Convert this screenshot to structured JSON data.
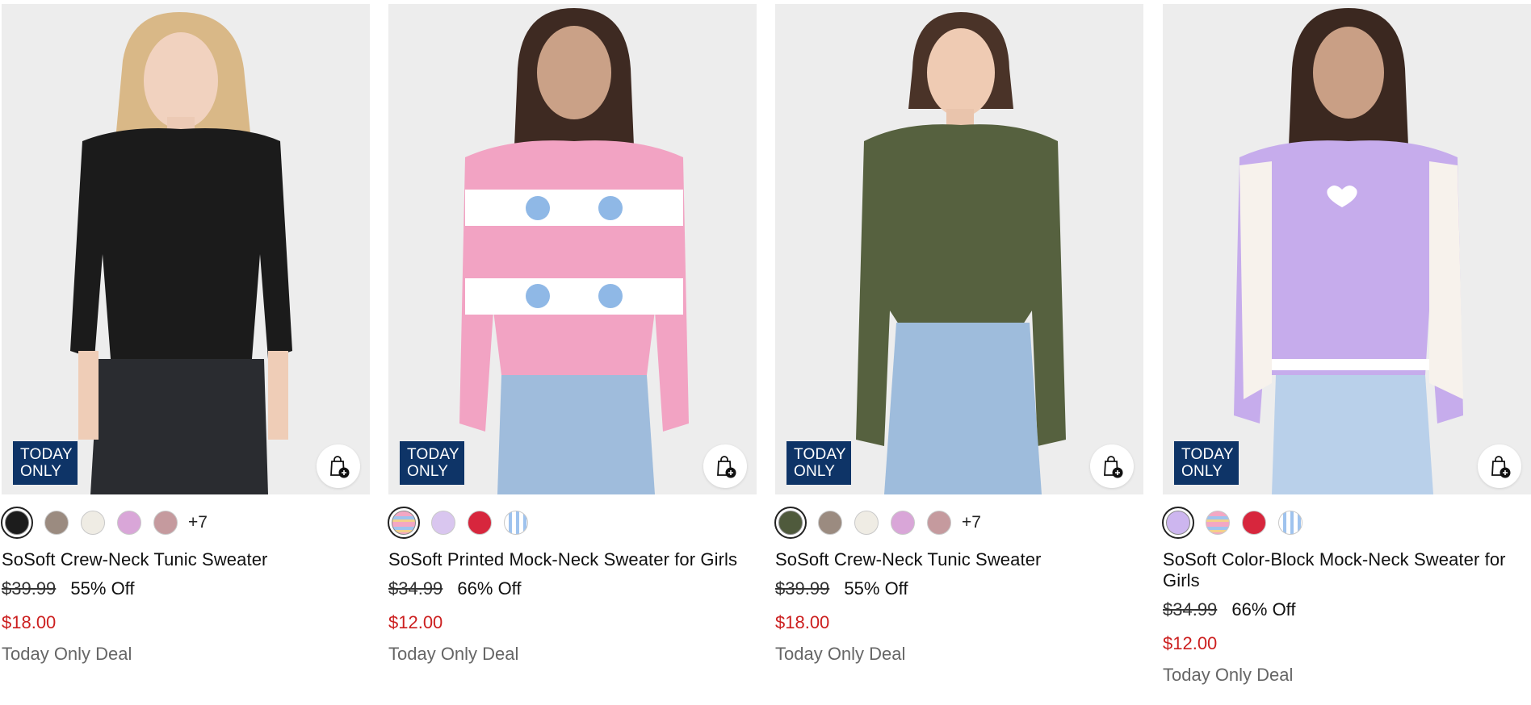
{
  "products": [
    {
      "badge_line1": "TODAY",
      "badge_line2": "ONLY",
      "name": "SoSoft Crew-Neck Tunic Sweater",
      "original_price": "$39.99",
      "discount": "55% Off",
      "sale_price": "$18.00",
      "deal_label": "Today Only Deal",
      "more_colors": "+7",
      "swatches": [
        "#1c1c1c",
        "#9b8b80",
        "#efece4",
        "#d9a6d8",
        "#c59a9e"
      ],
      "sweater_color": "#1b1b1b",
      "bottom_color": "#2a2c30"
    },
    {
      "badge_line1": "TODAY",
      "badge_line2": "ONLY",
      "name": "SoSoft Printed Mock-Neck Sweater for Girls",
      "original_price": "$34.99",
      "discount": "66% Off",
      "sale_price": "$12.00",
      "deal_label": "Today Only Deal",
      "more_colors": "",
      "swatches": [
        "#f3a7c4",
        "#d9c6ef",
        "#d7263d",
        "#bcd6f2"
      ],
      "sweater_color": "#f2a3c3",
      "bottom_color": "#9fbcdc"
    },
    {
      "badge_line1": "TODAY",
      "badge_line2": "ONLY",
      "name": "SoSoft Crew-Neck Tunic Sweater",
      "original_price": "$39.99",
      "discount": "55% Off",
      "sale_price": "$18.00",
      "deal_label": "Today Only Deal",
      "more_colors": "+7",
      "swatches": [
        "#4f5a3c",
        "#9b8b80",
        "#efece4",
        "#d9a6d8",
        "#c59a9e"
      ],
      "sweater_color": "#56613f",
      "bottom_color": "#9ebcdc"
    },
    {
      "badge_line1": "TODAY",
      "badge_line2": "ONLY",
      "name": "SoSoft Color-Block Mock-Neck Sweater for Girls",
      "original_price": "$34.99",
      "discount": "66% Off",
      "sale_price": "$12.00",
      "deal_label": "Today Only Deal",
      "more_colors": "",
      "swatches": [
        "#cdb6ef",
        "#f3a7c4",
        "#d7263d",
        "#bcd6f2"
      ],
      "sweater_color": "#c6acec",
      "bottom_color": "#b9d0ea"
    }
  ],
  "colors": {
    "badge_bg": "#0e3467",
    "sale_price": "#cc1f1f",
    "photo_bg": "#ececec"
  },
  "icons": {
    "add_to_bag": "shopping-bag-plus-icon"
  }
}
